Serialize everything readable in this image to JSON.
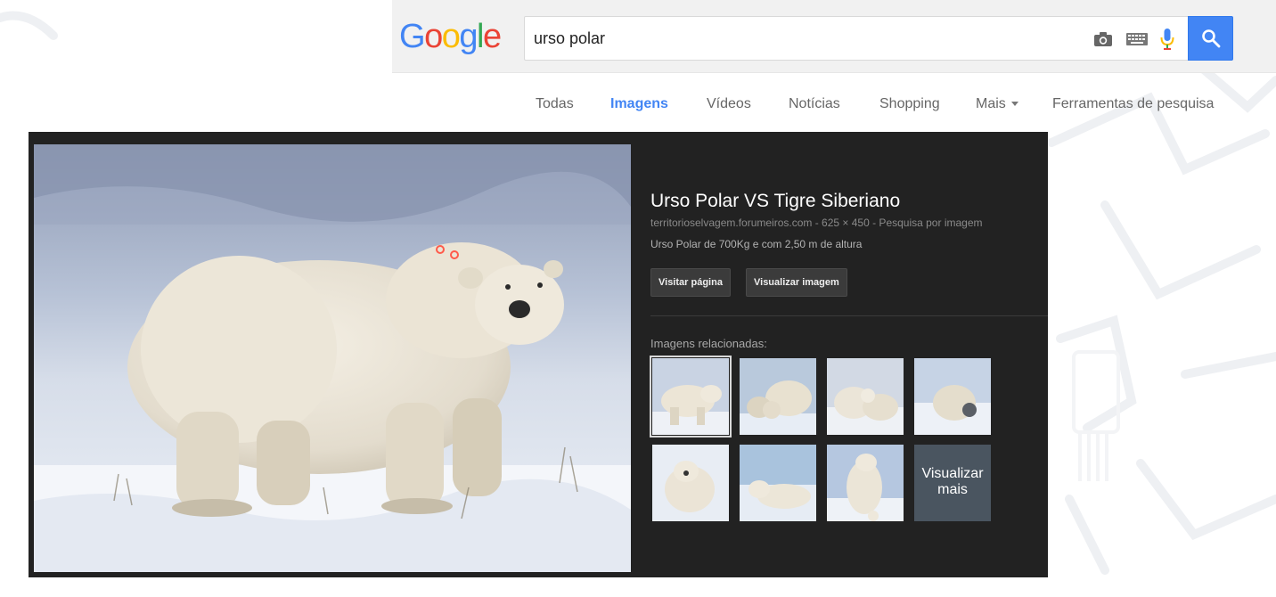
{
  "header": {
    "logo_letters": [
      "G",
      "o",
      "o",
      "g",
      "l",
      "e"
    ],
    "logo_colors": [
      "#4285f4",
      "#ea4335",
      "#fbbc05",
      "#4285f4",
      "#34a853",
      "#ea4335"
    ],
    "search_value": "urso polar",
    "icons": [
      "camera-icon",
      "keyboard-icon",
      "microphone-icon",
      "search-icon"
    ],
    "accent_color": "#4285f4"
  },
  "tabs": [
    {
      "label": "Todas",
      "active": false
    },
    {
      "label": "Imagens",
      "active": true
    },
    {
      "label": "Vídeos",
      "active": false
    },
    {
      "label": "Notícias",
      "active": false
    },
    {
      "label": "Shopping",
      "active": false
    },
    {
      "label": "Mais",
      "active": false
    },
    {
      "label": "Ferramentas de pesquisa",
      "active": false
    }
  ],
  "preview": {
    "title": "Urso Polar VS Tigre Siberiano",
    "meta": "territorioselvagem.forumeiros.com - 625 × 450 - Pesquisa por imagem",
    "description": "Urso Polar de 700Kg e com 2,50 m de altura",
    "visit_button": "Visitar página",
    "view_button": "Visualizar imagem",
    "related_label": "Imagens relacionadas:",
    "more_label": "Visualizar mais"
  },
  "colors": {
    "panel_bg": "#222222",
    "header_bg": "#f1f1f1"
  }
}
